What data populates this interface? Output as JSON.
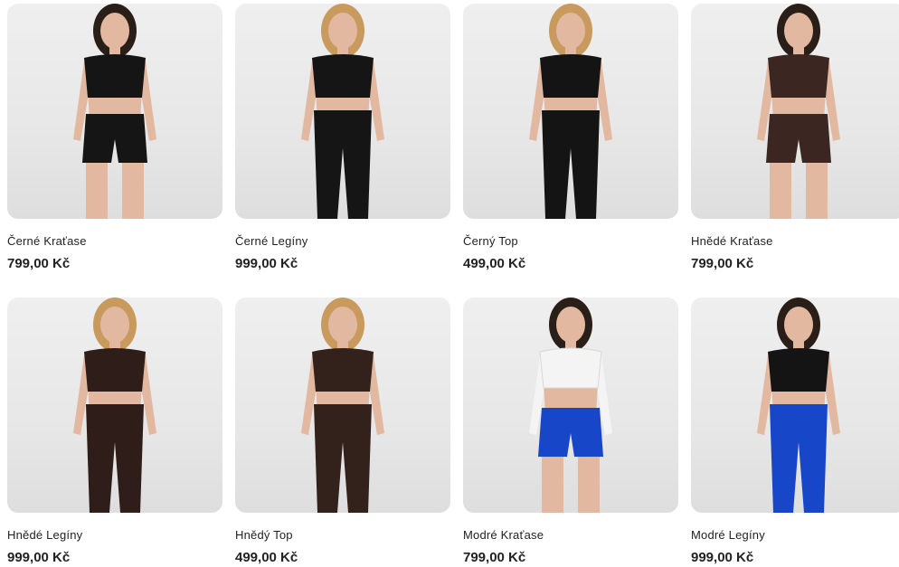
{
  "products": [
    {
      "name": "Černé Kraťase",
      "price": "799,00 Kč",
      "top_color": "#151515",
      "bottom_color": "#151515",
      "bottom_type": "shorts",
      "top_type": "tank",
      "image": "model-black-shorts"
    },
    {
      "name": "Černé Legíny",
      "price": "999,00 Kč",
      "top_color": "#151515",
      "bottom_color": "#151515",
      "bottom_type": "leggings",
      "top_type": "tank",
      "image": "model-black-leggings"
    },
    {
      "name": "Černý Top",
      "price": "499,00 Kč",
      "top_color": "#141414",
      "bottom_color": "#141414",
      "bottom_type": "leggings",
      "top_type": "tee",
      "image": "model-black-top"
    },
    {
      "name": "Hnědé Kraťase",
      "price": "799,00 Kč",
      "top_color": "#3b2622",
      "bottom_color": "#3b2622",
      "bottom_type": "shorts",
      "top_type": "tank",
      "image": "model-brown-shorts"
    },
    {
      "name": "Hnědé Legíny",
      "price": "999,00 Kč",
      "top_color": "#2e1d18",
      "bottom_color": "#2e1d18",
      "bottom_type": "leggings",
      "top_type": "tee",
      "image": "model-brown-leggings"
    },
    {
      "name": "Hnědý Top",
      "price": "499,00 Kč",
      "top_color": "#33211b",
      "bottom_color": "#33211b",
      "bottom_type": "leggings",
      "top_type": "tee",
      "image": "model-brown-top"
    },
    {
      "name": "Modré Kraťase",
      "price": "799,00 Kč",
      "top_color": "#f4f4f4",
      "bottom_color": "#1747c8",
      "bottom_type": "shorts",
      "top_type": "longsleeve",
      "image": "model-blue-shorts"
    },
    {
      "name": "Modré Legíny",
      "price": "999,00 Kč",
      "top_color": "#141414",
      "bottom_color": "#1747c8",
      "bottom_type": "leggings",
      "top_type": "tee",
      "image": "model-blue-leggings"
    }
  ],
  "colors": {
    "skin": "#e2b9a0",
    "hair_light": "#c99a5e",
    "hair_dark": "#2a1e18",
    "background": "#ececec"
  }
}
